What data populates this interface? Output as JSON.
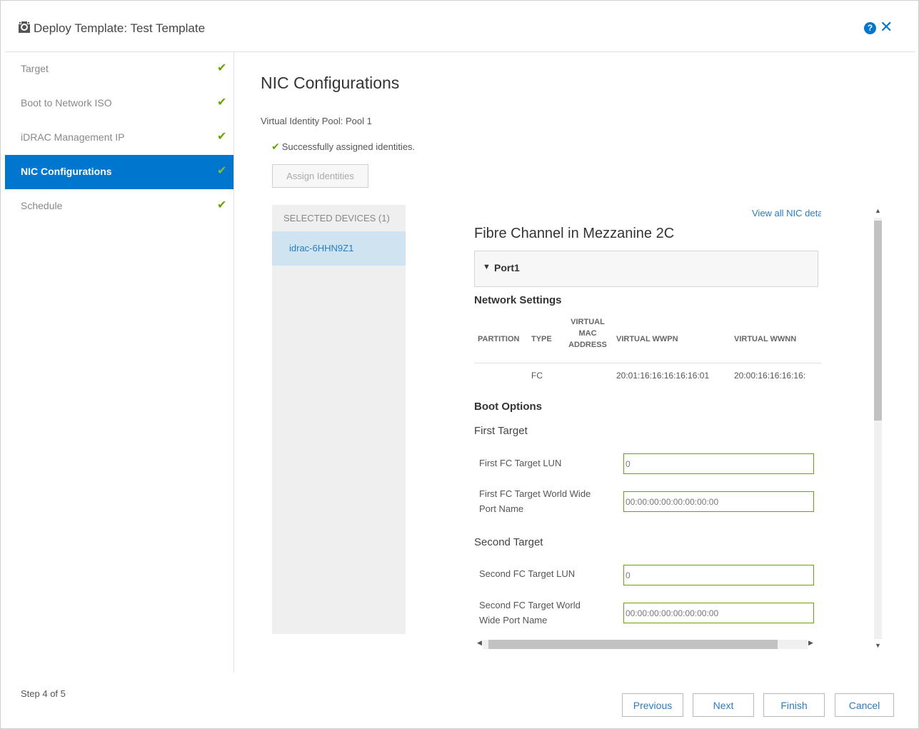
{
  "header": {
    "title": "Deploy Template: Test Template"
  },
  "sidebar": {
    "items": [
      {
        "label": "Target",
        "completed": true
      },
      {
        "label": "Boot to Network ISO",
        "completed": true
      },
      {
        "label": "iDRAC Management IP",
        "completed": true
      },
      {
        "label": "NIC Configurations",
        "completed": true,
        "active": true
      },
      {
        "label": "Schedule",
        "completed": true
      }
    ]
  },
  "main": {
    "title": "NIC Configurations",
    "pool": "Virtual Identity Pool: Pool 1",
    "success_message": "Successfully assigned identities.",
    "assign_button": "Assign Identities",
    "devices": {
      "header": "SELECTED DEVICES (1)",
      "items": [
        "idrac-6HHN9Z1"
      ]
    },
    "detail": {
      "view_all_link": "View all NIC details",
      "adapter_title": "Fibre Channel in Mezzanine 2C",
      "port_label": "Port1",
      "network_settings": {
        "heading": "Network Settings",
        "columns": {
          "partition": "PARTITION",
          "type": "TYPE",
          "mac_line1": "VIRTUAL",
          "mac_line2": "MAC",
          "mac_line3": "ADDRESS",
          "wwpn": "VIRTUAL WWPN",
          "wwnn": "VIRTUAL WWNN"
        },
        "row": {
          "partition": "",
          "type": "FC",
          "mac": "",
          "wwpn": "20:01:16:16:16:16:16:01",
          "wwnn": "20:00:16:16:16:16:"
        }
      },
      "boot_options": {
        "heading": "Boot Options",
        "first_target": {
          "heading": "First Target",
          "lun_label": "First FC Target LUN",
          "lun_value": "0",
          "wwpn_label_line1": "First FC Target World Wide",
          "wwpn_label_line2": "Port Name",
          "wwpn_value": "00:00:00:00:00:00:00:00"
        },
        "second_target": {
          "heading": "Second Target",
          "lun_label": "Second FC Target LUN",
          "lun_value": "0",
          "wwpn_label_line1": "Second FC Target World",
          "wwpn_label_line2": "Wide Port Name",
          "wwpn_value": "00:00:00:00:00:00:00:00"
        }
      }
    }
  },
  "footer": {
    "step": "Step 4 of 5",
    "buttons": {
      "previous": "Previous",
      "next": "Next",
      "finish": "Finish",
      "cancel": "Cancel"
    }
  },
  "colors": {
    "accent": "#0076ce",
    "success": "#6ea204",
    "link": "#2a7cc1",
    "selected_row": "#cfe4f0"
  },
  "icons": {
    "app": "template-deploy-icon",
    "help": "help-icon",
    "close": "close-icon",
    "check": "checkmark-icon",
    "expand": "chevron-down-icon"
  }
}
